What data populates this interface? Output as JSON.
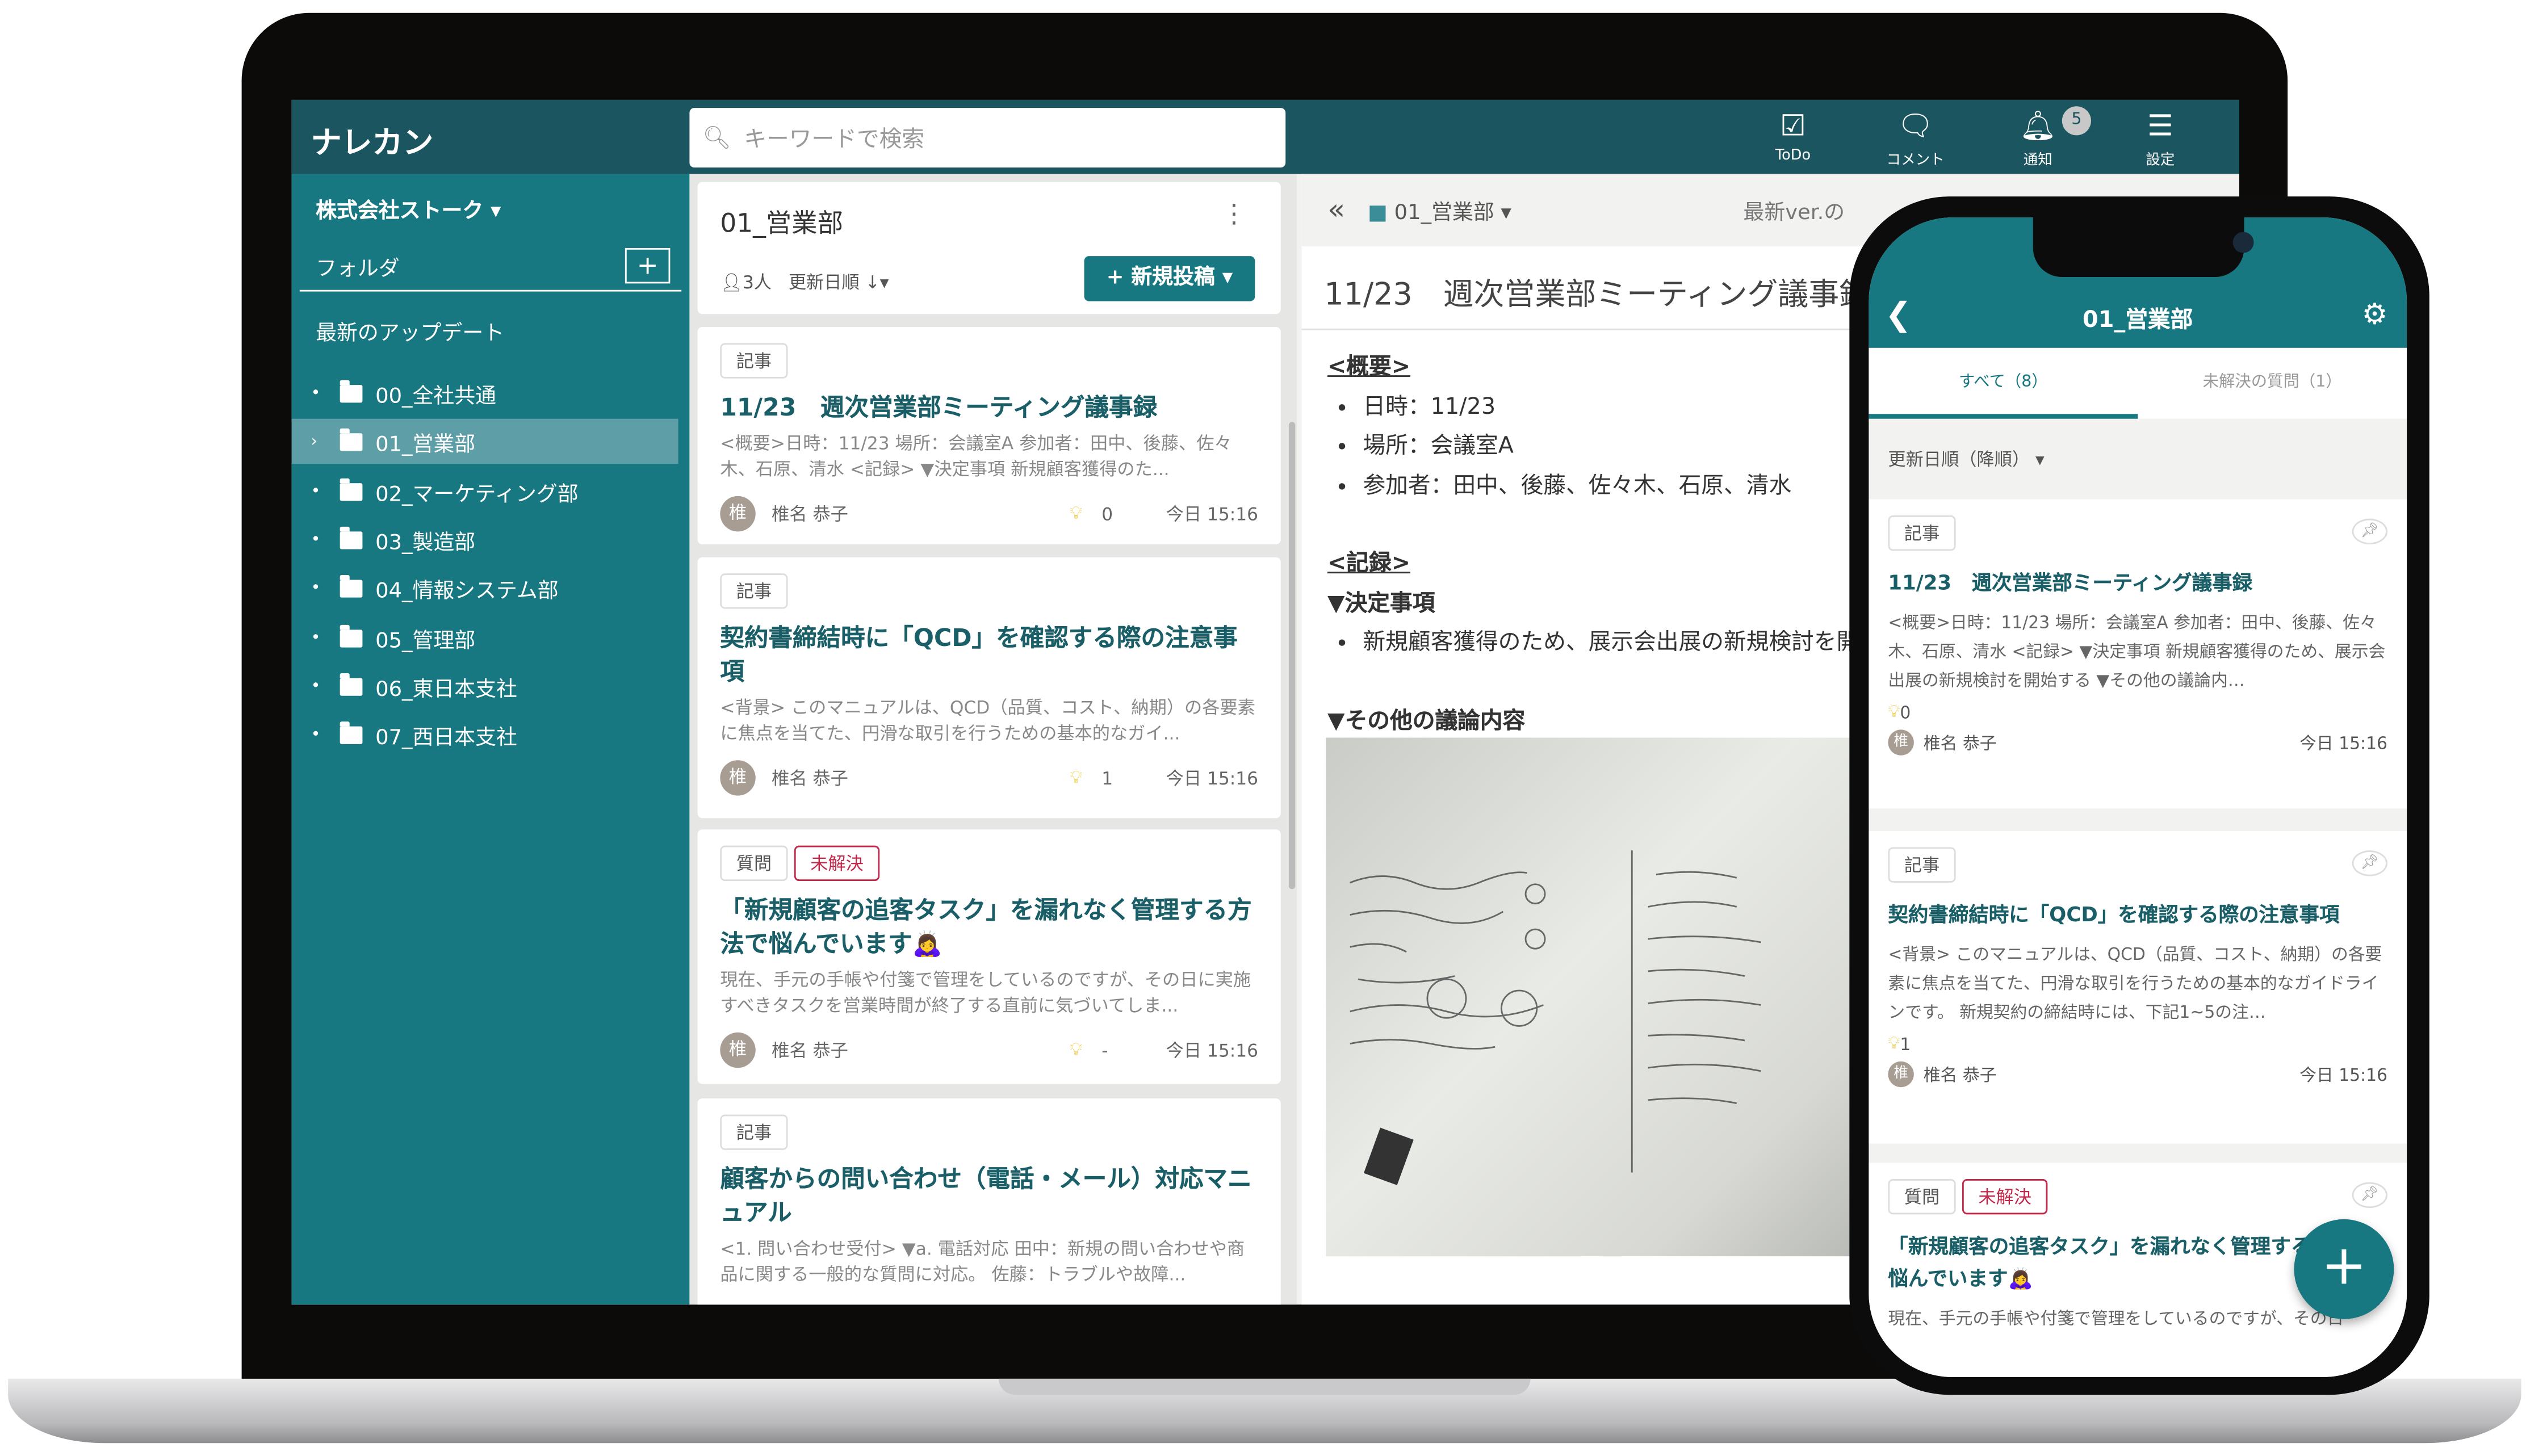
{
  "app": {
    "logo": "ナレカン"
  },
  "search": {
    "placeholder": "キーワードで検索"
  },
  "toolbar": {
    "todo": "ToDo",
    "comment": "コメント",
    "notify": "通知",
    "settings": "設定",
    "notify_badge": "5"
  },
  "sidebar": {
    "company": "株式会社ストーク ▾",
    "folder_label": "フォルダ",
    "add": "+",
    "latest": "最新のアップデート",
    "folders": [
      {
        "label": "00_全社共通"
      },
      {
        "label": "01_営業部",
        "selected": true
      },
      {
        "label": "02_マーケティング部"
      },
      {
        "label": "03_製造部"
      },
      {
        "label": "04_情報システム部"
      },
      {
        "label": "05_管理部"
      },
      {
        "label": "06_東日本支社"
      },
      {
        "label": "07_西日本支社"
      }
    ]
  },
  "list": {
    "title": "01_営業部",
    "members": "3人",
    "sort": "更新日順 ↓▾",
    "new_post": "+ 新規投稿 ▾",
    "cards": [
      {
        "tag": "記事",
        "title": "11/23　週次営業部ミーティング議事録",
        "excerpt": "<概要>日時：11/23 場所：会議室A 参加者：田中、後藤、佐々木、石原、清水 <記録> ▼決定事項 新規顧客獲得のた...",
        "avatar": "椎",
        "author": "椎名 恭子",
        "likes": "0",
        "time": "今日 15:16"
      },
      {
        "tag": "記事",
        "title": "契約書締結時に「QCD」を確認する際の注意事項",
        "excerpt": "<背景> このマニュアルは、QCD（品質、コスト、納期）の各要素に焦点を当てた、円滑な取引を行うための基本的なガイ...",
        "avatar": "椎",
        "author": "椎名 恭子",
        "likes": "1",
        "time": "今日 15:16"
      },
      {
        "tag": "質問",
        "status": "未解決",
        "title": "「新規顧客の追客タスク」を漏れなく管理する方法で悩んでいます🙇‍♀️",
        "excerpt": "現在、手元の手帳や付箋で管理をしているのですが、その日に実施すべきタスクを営業時間が終了する直前に気づいてしま...",
        "avatar": "椎",
        "author": "椎名 恭子",
        "likes": "-",
        "time": "今日 15:16"
      },
      {
        "tag": "記事",
        "title": "顧客からの問い合わせ（電話・メール）対応マニュアル",
        "excerpt": "<1. 問い合わせ受付> ▼a. 電話対応 田中：新規の問い合わせや商品に関する一般的な質問に対応。 佐藤：トラブルや故障..."
      }
    ]
  },
  "detail": {
    "collapse": "«",
    "folder": "01_営業部 ▾",
    "version": "最新ver.の",
    "title": "11/23　週次営業部ミーティング議事録",
    "overview_h": "<概要>",
    "overview": [
      "日時：11/23",
      "場所：会議室A",
      "参加者：田中、後藤、佐々木、石原、清水"
    ],
    "record_h": "<記録>",
    "decision_h": "▼決定事項",
    "decisions": [
      "新規顧客獲得のため、展示会出展の新規検討を開始する"
    ],
    "other_h": "▼その他の議論内容"
  },
  "phone": {
    "title": "01_営業部",
    "tabs": [
      {
        "label": "すべて（8）",
        "active": true
      },
      {
        "label": "未解決の質問（1）"
      }
    ],
    "sort": "更新日順（降順） ▾",
    "cards": [
      {
        "tag": "記事",
        "title": "11/23　週次営業部ミーティング議事録",
        "excerpt": "<概要>日時：11/23 場所：会議室A 参加者：田中、後藤、佐々木、石原、清水 <記録> ▼決定事項 新規顧客獲得のため、展示会出展の新規検討を開始する ▼その他の議論内…",
        "likes": "0",
        "avatar": "椎",
        "author": "椎名 恭子",
        "time": "今日 15:16"
      },
      {
        "tag": "記事",
        "title": "契約書締結時に「QCD」を確認する際の注意事項",
        "excerpt": "<背景> このマニュアルは、QCD（品質、コスト、納期）の各要素に焦点を当てた、円滑な取引を行うための基本的なガイドラインです。 新規契約の締結時には、下記1~5の注…",
        "likes": "1",
        "avatar": "椎",
        "author": "椎名 恭子",
        "time": "今日 15:16"
      },
      {
        "tag": "質問",
        "status": "未解決",
        "title": "「新規顧客の追客タスク」を漏れなく管理する方法で悩んでいます🙇‍♀️",
        "excerpt": "現在、手元の手帳や付箋で管理をしているのですが、その日"
      }
    ],
    "fab": "+"
  },
  "colors": {
    "header": "#1b5660",
    "accent": "#187882",
    "unresolved": "#c2284a"
  }
}
